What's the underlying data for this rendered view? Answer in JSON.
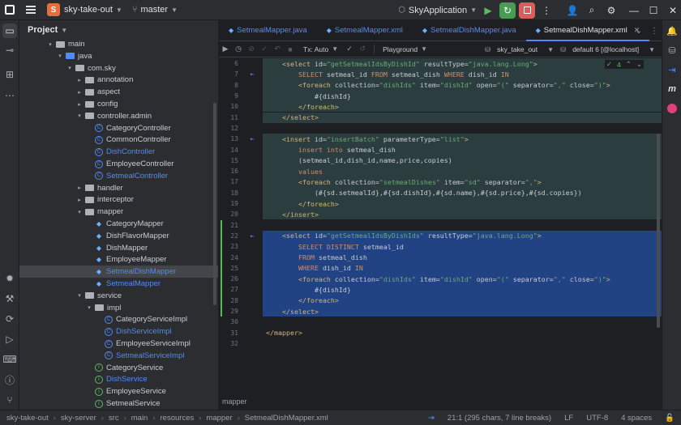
{
  "titlebar": {
    "project_badge": "S",
    "project_name": "sky-take-out",
    "branch": "master",
    "run_config": "SkyApplication"
  },
  "project_panel": {
    "title": "Project",
    "tree": [
      {
        "label": "main",
        "kind": "folder",
        "depth": 3,
        "open": true,
        "color": "normal"
      },
      {
        "label": "java",
        "kind": "folder-blue",
        "depth": 4,
        "open": true,
        "color": "normal"
      },
      {
        "label": "com.sky",
        "kind": "package",
        "depth": 5,
        "open": true,
        "color": "normal"
      },
      {
        "label": "annotation",
        "kind": "package",
        "depth": 6,
        "open": false,
        "color": "normal"
      },
      {
        "label": "aspect",
        "kind": "package",
        "depth": 6,
        "open": false,
        "color": "normal"
      },
      {
        "label": "config",
        "kind": "package",
        "depth": 6,
        "open": false,
        "color": "normal"
      },
      {
        "label": "controller.admin",
        "kind": "package",
        "depth": 6,
        "open": true,
        "color": "normal"
      },
      {
        "label": "CategoryController",
        "kind": "class",
        "depth": 7,
        "color": "normal"
      },
      {
        "label": "CommonController",
        "kind": "class",
        "depth": 7,
        "color": "normal"
      },
      {
        "label": "DishController",
        "kind": "class",
        "depth": 7,
        "color": "blue"
      },
      {
        "label": "EmployeeController",
        "kind": "class",
        "depth": 7,
        "color": "normal"
      },
      {
        "label": "SetmealController",
        "kind": "class",
        "depth": 7,
        "color": "blue"
      },
      {
        "label": "handler",
        "kind": "package",
        "depth": 6,
        "open": false,
        "color": "normal"
      },
      {
        "label": "interceptor",
        "kind": "package",
        "depth": 6,
        "open": false,
        "color": "normal"
      },
      {
        "label": "mapper",
        "kind": "package",
        "depth": 6,
        "open": true,
        "color": "normal"
      },
      {
        "label": "CategoryMapper",
        "kind": "xml",
        "depth": 7,
        "color": "normal"
      },
      {
        "label": "DishFlavorMapper",
        "kind": "xml",
        "depth": 7,
        "color": "normal"
      },
      {
        "label": "DishMapper",
        "kind": "xml",
        "depth": 7,
        "color": "normal"
      },
      {
        "label": "EmployeeMapper",
        "kind": "xml",
        "depth": 7,
        "color": "normal"
      },
      {
        "label": "SetmealDishMapper",
        "kind": "xml",
        "depth": 7,
        "color": "blue",
        "selected": true
      },
      {
        "label": "SetmealMapper",
        "kind": "xml",
        "depth": 7,
        "color": "blue"
      },
      {
        "label": "service",
        "kind": "package",
        "depth": 6,
        "open": true,
        "color": "normal"
      },
      {
        "label": "impl",
        "kind": "package",
        "depth": 7,
        "open": true,
        "color": "normal"
      },
      {
        "label": "CategoryServiceImpl",
        "kind": "class",
        "depth": 8,
        "color": "normal"
      },
      {
        "label": "DishServiceImpl",
        "kind": "class",
        "depth": 8,
        "color": "blue"
      },
      {
        "label": "EmployeeServiceImpl",
        "kind": "class",
        "depth": 8,
        "color": "normal"
      },
      {
        "label": "SetmealServiceImpl",
        "kind": "class",
        "depth": 8,
        "color": "blue"
      },
      {
        "label": "CategoryService",
        "kind": "iface",
        "depth": 7,
        "color": "normal"
      },
      {
        "label": "DishService",
        "kind": "iface",
        "depth": 7,
        "color": "blue"
      },
      {
        "label": "EmployeeService",
        "kind": "iface",
        "depth": 7,
        "color": "normal"
      },
      {
        "label": "SetmealService",
        "kind": "iface",
        "depth": 7,
        "color": "normal"
      }
    ]
  },
  "editor": {
    "tabs": [
      {
        "label": "SetmealMapper.java",
        "active": false
      },
      {
        "label": "SetmealMapper.xml",
        "active": false
      },
      {
        "label": "SetmealDishMapper.java",
        "active": false
      },
      {
        "label": "SetmealDishMapper.xml",
        "active": true
      }
    ],
    "toolbar": {
      "tx": "Tx: Auto",
      "playground": "Playground",
      "schema": "sky_take_out",
      "datasource": "default 6 [@localhost]"
    },
    "hint_count": "4",
    "breadcrumb": "mapper",
    "lines": [
      {
        "n": "6",
        "gutter": "",
        "bg": "teal",
        "parts": [
          [
            "t",
            "    "
          ],
          [
            "tag",
            "<select"
          ],
          [
            "a",
            " id="
          ],
          [
            "s",
            "\"getSetmealIdsByDishId\""
          ],
          [
            "a",
            " resultType="
          ],
          [
            "s",
            "\"java.lang.Long\""
          ],
          [
            "tag",
            ">"
          ]
        ]
      },
      {
        "n": "7",
        "gutter": "map",
        "bg": "teal",
        "parts": [
          [
            "t",
            "        "
          ],
          [
            "kw",
            "SELECT"
          ],
          [
            "t",
            " setmeal_id "
          ],
          [
            "kw",
            "FROM"
          ],
          [
            "t",
            " setmeal_dish "
          ],
          [
            "kw",
            "WHERE"
          ],
          [
            "t",
            " dish_id "
          ],
          [
            "kw",
            "IN"
          ]
        ]
      },
      {
        "n": "8",
        "gutter": "",
        "bg": "teal",
        "parts": [
          [
            "t",
            "        "
          ],
          [
            "tag",
            "<foreach"
          ],
          [
            "a",
            " collection="
          ],
          [
            "s",
            "\"dishIds\""
          ],
          [
            "a",
            " item="
          ],
          [
            "s",
            "\"dishId\""
          ],
          [
            "a",
            " open="
          ],
          [
            "s",
            "\"(\""
          ],
          [
            "a",
            " separator="
          ],
          [
            "s",
            "\",\""
          ],
          [
            "a",
            " close="
          ],
          [
            "s",
            "\")\""
          ],
          [
            "tag",
            ">"
          ]
        ]
      },
      {
        "n": "9",
        "gutter": "",
        "bg": "teal",
        "parts": [
          [
            "t",
            "            #{dishId}"
          ]
        ]
      },
      {
        "n": "10",
        "gutter": "",
        "bg": "teal",
        "parts": [
          [
            "t",
            "        "
          ],
          [
            "tag",
            "</foreach>"
          ]
        ]
      },
      {
        "n": "11",
        "gutter": "",
        "bg": "teal",
        "parts": [
          [
            "t",
            "    "
          ],
          [
            "tag",
            "</select>"
          ]
        ]
      },
      {
        "n": "12",
        "gutter": "",
        "bg": "",
        "parts": [
          [
            "t",
            ""
          ]
        ]
      },
      {
        "n": "13",
        "gutter": "map",
        "bg": "teal",
        "parts": [
          [
            "t",
            "    "
          ],
          [
            "tag",
            "<insert"
          ],
          [
            "a",
            " id="
          ],
          [
            "s",
            "\"insertBatch\""
          ],
          [
            "a",
            " parameterType="
          ],
          [
            "s",
            "\"list\""
          ],
          [
            "tag",
            ">"
          ]
        ]
      },
      {
        "n": "14",
        "gutter": "",
        "bg": "teal",
        "parts": [
          [
            "t",
            "        "
          ],
          [
            "kw",
            "insert into"
          ],
          [
            "t",
            " setmeal_dish"
          ]
        ]
      },
      {
        "n": "15",
        "gutter": "",
        "bg": "teal",
        "parts": [
          [
            "t",
            "        (setmeal_id,dish_id,name,price,copies)"
          ]
        ]
      },
      {
        "n": "16",
        "gutter": "",
        "bg": "teal",
        "parts": [
          [
            "t",
            "        "
          ],
          [
            "kw",
            "values"
          ]
        ]
      },
      {
        "n": "17",
        "gutter": "",
        "bg": "teal",
        "parts": [
          [
            "t",
            "        "
          ],
          [
            "tag",
            "<foreach"
          ],
          [
            "a",
            " collection="
          ],
          [
            "s",
            "\"setmealDishes\""
          ],
          [
            "a",
            " item="
          ],
          [
            "s",
            "\"sd\""
          ],
          [
            "a",
            " separator="
          ],
          [
            "s",
            "\",\""
          ],
          [
            "tag",
            ">"
          ]
        ]
      },
      {
        "n": "18",
        "gutter": "",
        "bg": "teal",
        "parts": [
          [
            "t",
            "            (#{sd.setmealId},#{sd.dishId},#{sd.name},#{sd.price},#{sd.copies})"
          ]
        ]
      },
      {
        "n": "19",
        "gutter": "",
        "bg": "teal",
        "parts": [
          [
            "t",
            "        "
          ],
          [
            "tag",
            "</foreach>"
          ]
        ]
      },
      {
        "n": "20",
        "gutter": "",
        "bg": "teal",
        "parts": [
          [
            "t",
            "    "
          ],
          [
            "tag",
            "</insert>"
          ]
        ]
      },
      {
        "n": "21",
        "gutter": "",
        "bg": "",
        "parts": [
          [
            "t",
            ""
          ]
        ]
      },
      {
        "n": "22",
        "gutter": "map",
        "bg": "sel",
        "parts": [
          [
            "t",
            "    "
          ],
          [
            "tag",
            "<select"
          ],
          [
            "a",
            " id="
          ],
          [
            "s",
            "\"getSetmealIdsByDishIds\""
          ],
          [
            "a",
            " resultType="
          ],
          [
            "s",
            "\"java.lang.Long\""
          ],
          [
            "tag",
            ">"
          ]
        ]
      },
      {
        "n": "23",
        "gutter": "",
        "bg": "sel",
        "parts": [
          [
            "t",
            "        "
          ],
          [
            "kw",
            "SELECT DISTINCT"
          ],
          [
            "t",
            " setmeal_id"
          ]
        ]
      },
      {
        "n": "24",
        "gutter": "",
        "bg": "sel",
        "parts": [
          [
            "t",
            "        "
          ],
          [
            "kw",
            "FROM"
          ],
          [
            "t",
            " setmeal_dish"
          ]
        ]
      },
      {
        "n": "25",
        "gutter": "",
        "bg": "sel",
        "parts": [
          [
            "t",
            "        "
          ],
          [
            "kw",
            "WHERE"
          ],
          [
            "t",
            " dish_id "
          ],
          [
            "kw",
            "IN"
          ]
        ]
      },
      {
        "n": "26",
        "gutter": "",
        "bg": "sel",
        "parts": [
          [
            "t",
            "        "
          ],
          [
            "tag",
            "<foreach"
          ],
          [
            "a",
            " collection="
          ],
          [
            "s",
            "\"dishIds\""
          ],
          [
            "a",
            " item="
          ],
          [
            "s",
            "\"dishId\""
          ],
          [
            "a",
            " open="
          ],
          [
            "s",
            "\"(\""
          ],
          [
            "a",
            " separator="
          ],
          [
            "s",
            "\",\""
          ],
          [
            "a",
            " close="
          ],
          [
            "s",
            "\")\""
          ],
          [
            "tag",
            ">"
          ]
        ]
      },
      {
        "n": "27",
        "gutter": "",
        "bg": "sel",
        "parts": [
          [
            "t",
            "            #{dishId}"
          ]
        ]
      },
      {
        "n": "28",
        "gutter": "",
        "bg": "sel",
        "parts": [
          [
            "t",
            "        "
          ],
          [
            "tag",
            "</foreach>"
          ]
        ]
      },
      {
        "n": "29",
        "gutter": "",
        "bg": "sel",
        "parts": [
          [
            "t",
            "    "
          ],
          [
            "tag",
            "</select>"
          ]
        ]
      },
      {
        "n": "30",
        "gutter": "",
        "bg": "",
        "parts": [
          [
            "t",
            ""
          ]
        ]
      },
      {
        "n": "31",
        "gutter": "",
        "bg": "",
        "parts": [
          [
            "tag",
            "</mapper>"
          ]
        ]
      },
      {
        "n": "32",
        "gutter": "",
        "bg": "",
        "parts": [
          [
            "t",
            ""
          ]
        ]
      }
    ]
  },
  "statusbar": {
    "crumbs": [
      "sky-take-out",
      "sky-server",
      "src",
      "main",
      "resources",
      "mapper",
      "SetmealDishMapper.xml"
    ],
    "position": "21:1 (295 chars, 7 line breaks)",
    "line_sep": "LF",
    "encoding": "UTF-8",
    "indent": "4 spaces"
  }
}
